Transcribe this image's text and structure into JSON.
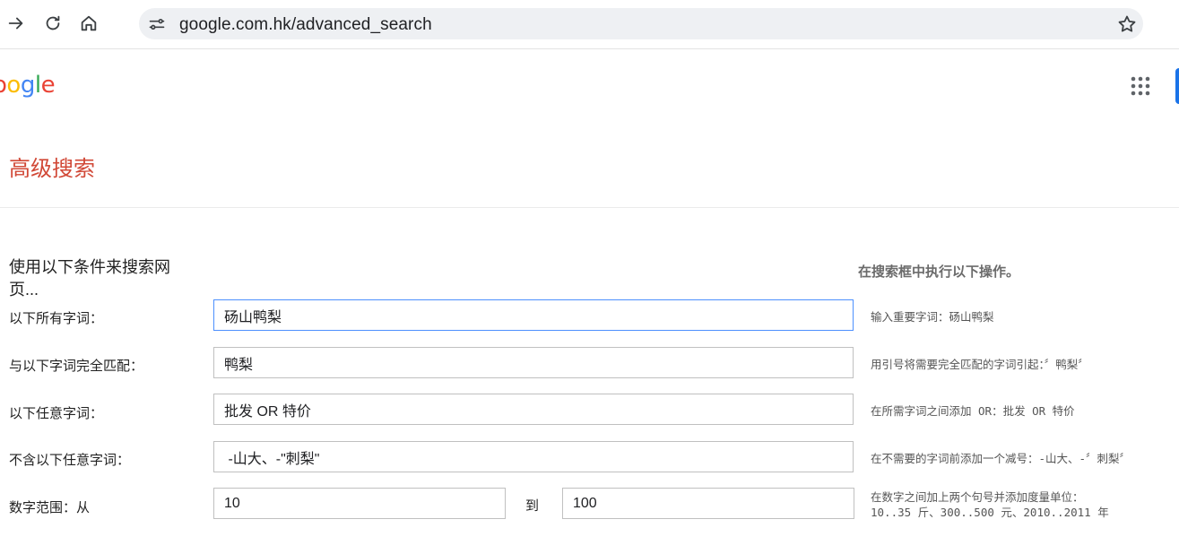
{
  "browser": {
    "url": "google.com.hk/advanced_search",
    "icons": [
      "forward-icon",
      "reload-icon",
      "home-icon",
      "site-settings-icon",
      "bookmark-star-icon"
    ]
  },
  "header": {
    "logo_text": "oogle",
    "logo_colors": [
      "#ea4335",
      "#4285f4",
      "#fbbc05",
      "#4285f4",
      "#34a853",
      "#ea4335"
    ],
    "apps_icon": "apps-grid-icon"
  },
  "page": {
    "title": "高级搜索",
    "section_title": "使用以下条件来搜索网页...",
    "hint_title": "在搜索框中执行以下操作。"
  },
  "rows": [
    {
      "label": "以下所有字词：",
      "value": "砀山鸭梨",
      "hint": "输入重要字词：砀山鸭梨"
    },
    {
      "label": "与以下字词完全匹配：",
      "value": "鸭梨",
      "hint": "用引号将需要完全匹配的字词引起：〞鸭梨〞"
    },
    {
      "label": "以下任意字词：",
      "value": "批发 OR 特价",
      "hint": "在所需字词之间添加 OR：批发 OR 特价"
    },
    {
      "label": "不含以下任意字词：",
      "value": " -山大、-\"刺梨\"",
      "hint": "在不需要的字词前添加一个减号：-山大、-〞刺梨〞"
    }
  ],
  "range": {
    "label": "数字范围：从",
    "from": "10",
    "to_label": "到",
    "to": "100",
    "hint_line1": "在数字之间加上两个句号并添加度量单位：",
    "hint_line2": "10..35 斤、300..500 元、2010..2011 年"
  },
  "colors": {
    "title": "#d14836",
    "focus_border": "#4d90fe",
    "accent": "#1a73e8"
  }
}
